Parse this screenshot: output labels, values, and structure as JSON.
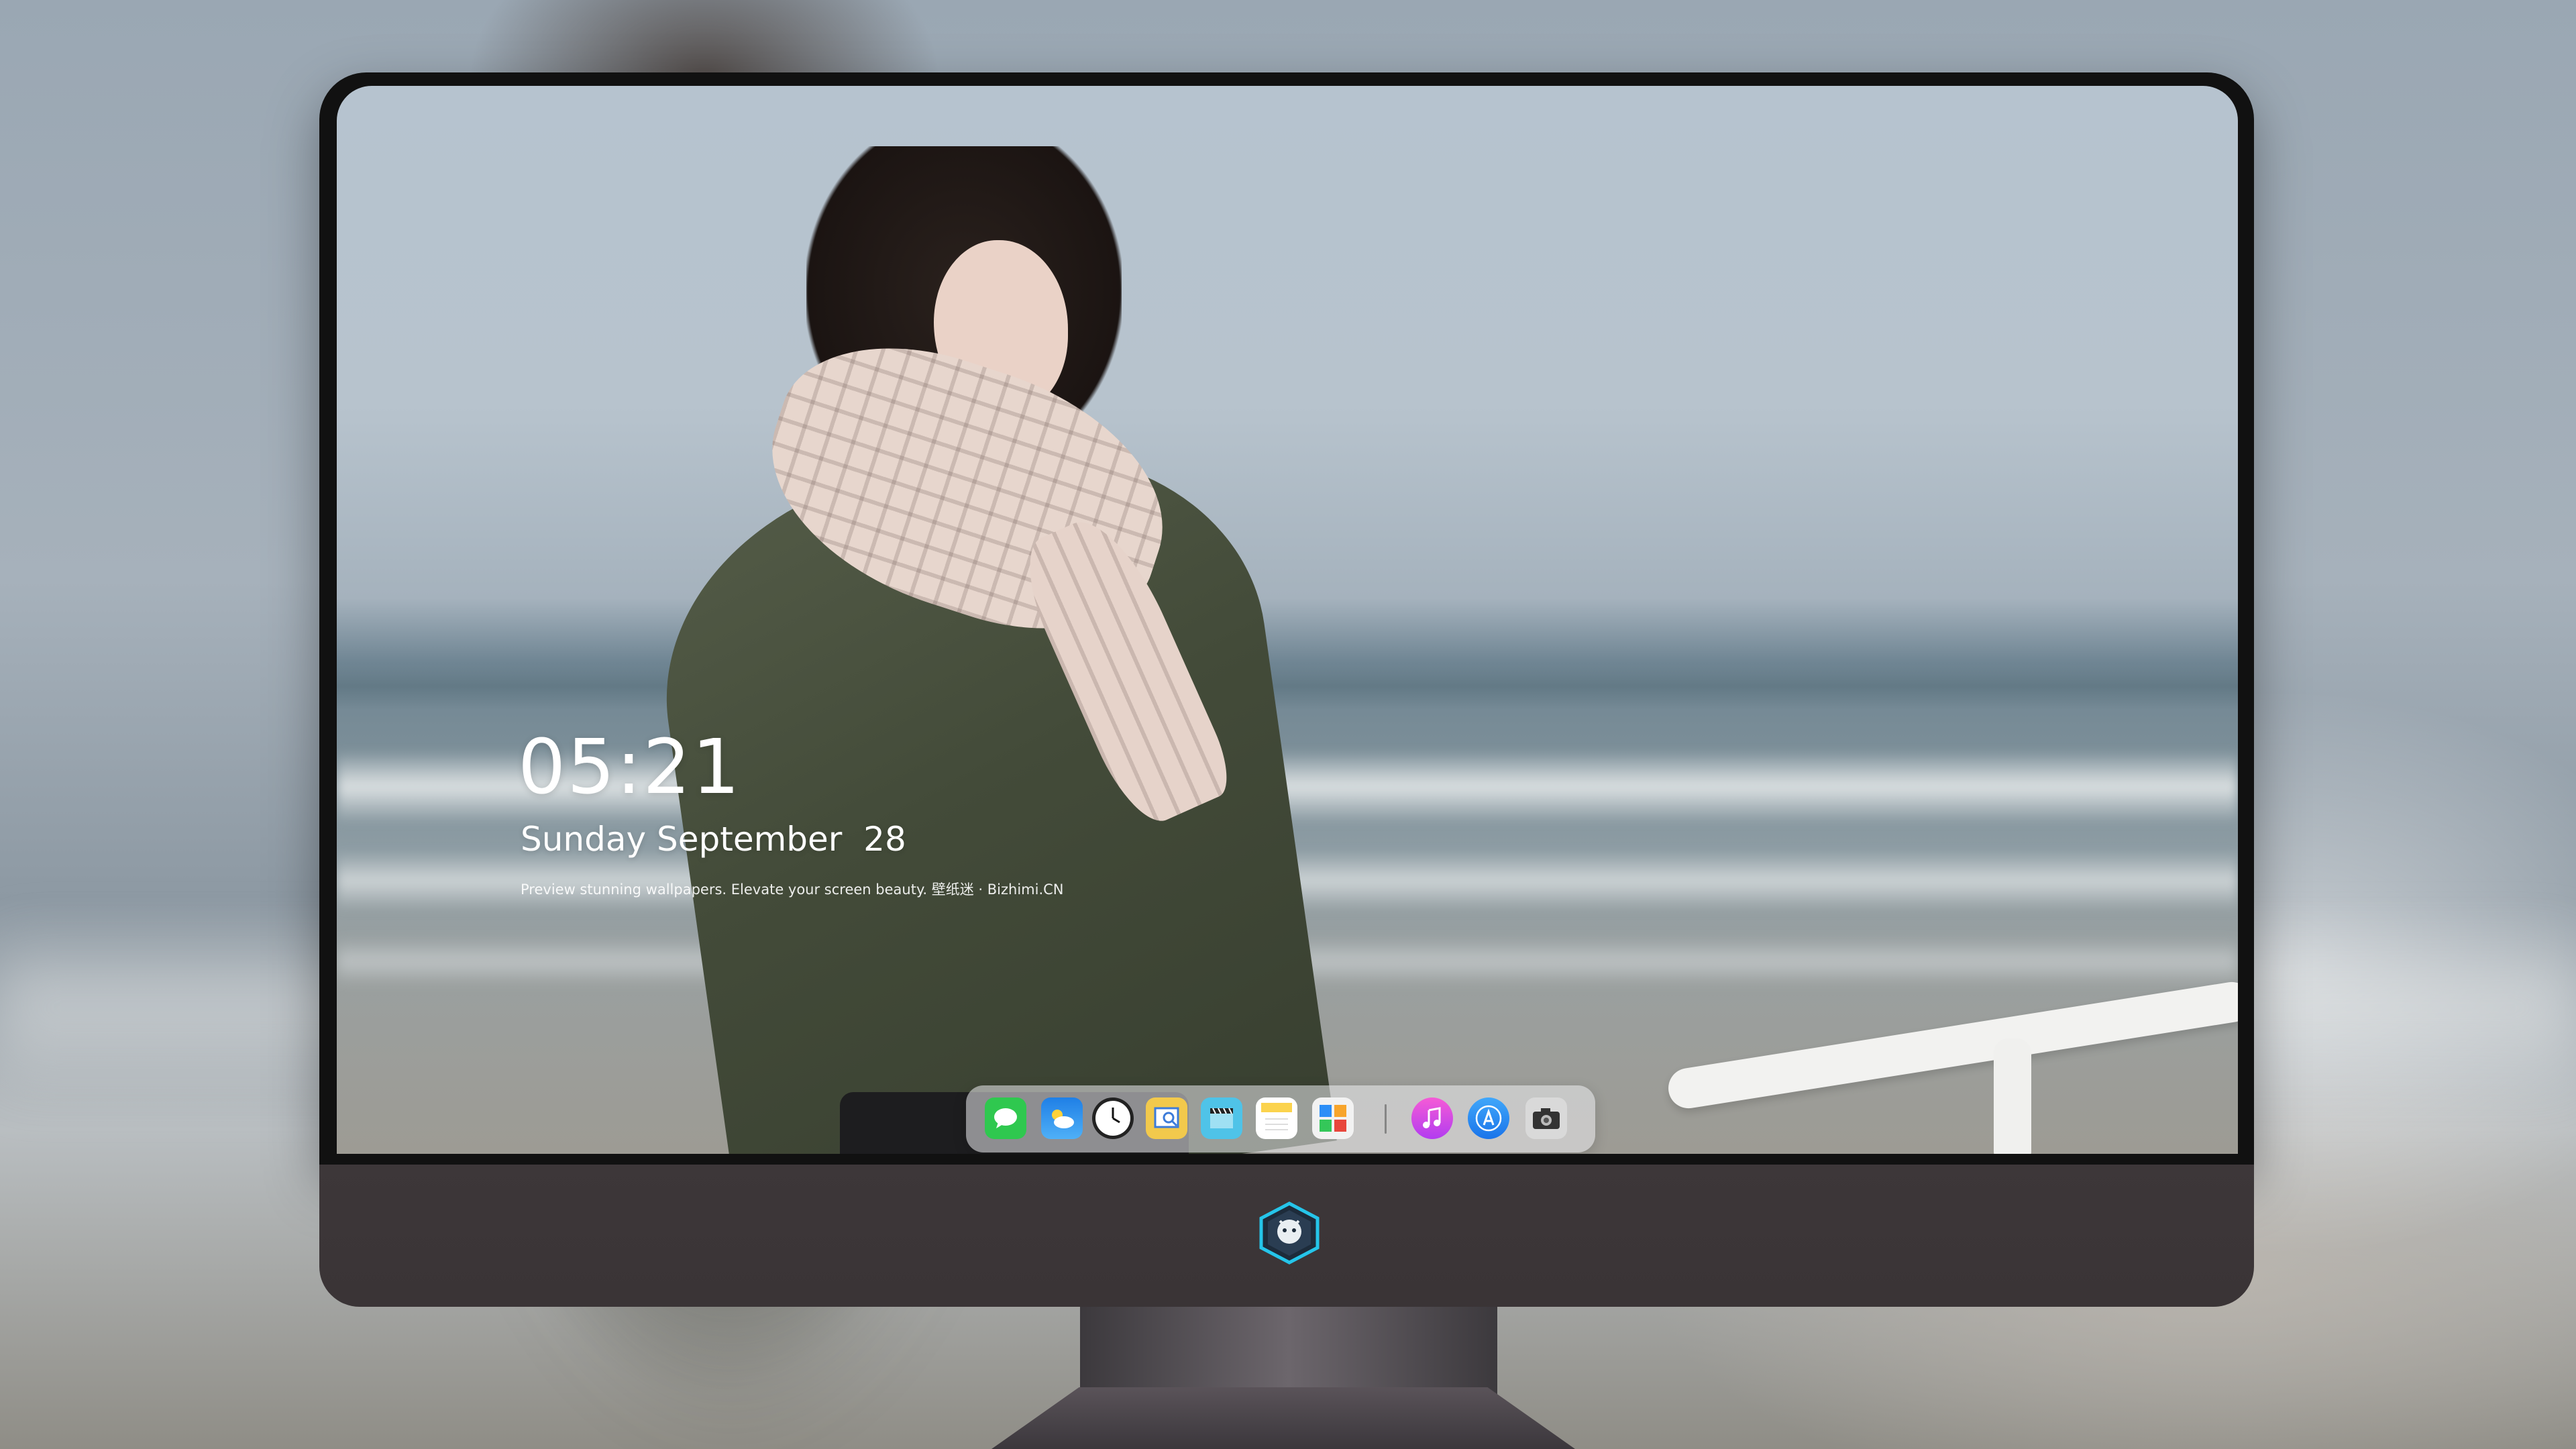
{
  "lockscreen": {
    "time": "05:21",
    "date": "Sunday September  28",
    "tagline": "Preview stunning wallpapers. Elevate your screen beauty. 壁纸迷 · Bizhimi.CN"
  },
  "dock": {
    "items": [
      {
        "name": "messages",
        "icon": "messages-icon",
        "color": "#2fc84f"
      },
      {
        "name": "weather",
        "icon": "weather-icon",
        "color": "#2e8ff0"
      },
      {
        "name": "clock",
        "icon": "clock-icon",
        "color": "#ffffff"
      },
      {
        "name": "preview",
        "icon": "preview-icon",
        "color": "#f2c94c"
      },
      {
        "name": "clips",
        "icon": "clapperboard-icon",
        "color": "#4fc3e8"
      },
      {
        "name": "notes",
        "icon": "notes-icon",
        "color": "#fbd34d"
      },
      {
        "name": "photos-grid",
        "icon": "grid-icon",
        "color": "#f2f2f2"
      },
      {
        "name": "itunes",
        "icon": "music-icon",
        "color": "#e84fd3"
      },
      {
        "name": "app-store",
        "icon": "app-store-icon",
        "color": "#2c8ef7"
      },
      {
        "name": "camera",
        "icon": "camera-icon",
        "color": "#666666"
      }
    ]
  },
  "colors": {
    "chin": "#3d3739",
    "frame": "#111111",
    "logo_accent": "#25c5ea"
  }
}
